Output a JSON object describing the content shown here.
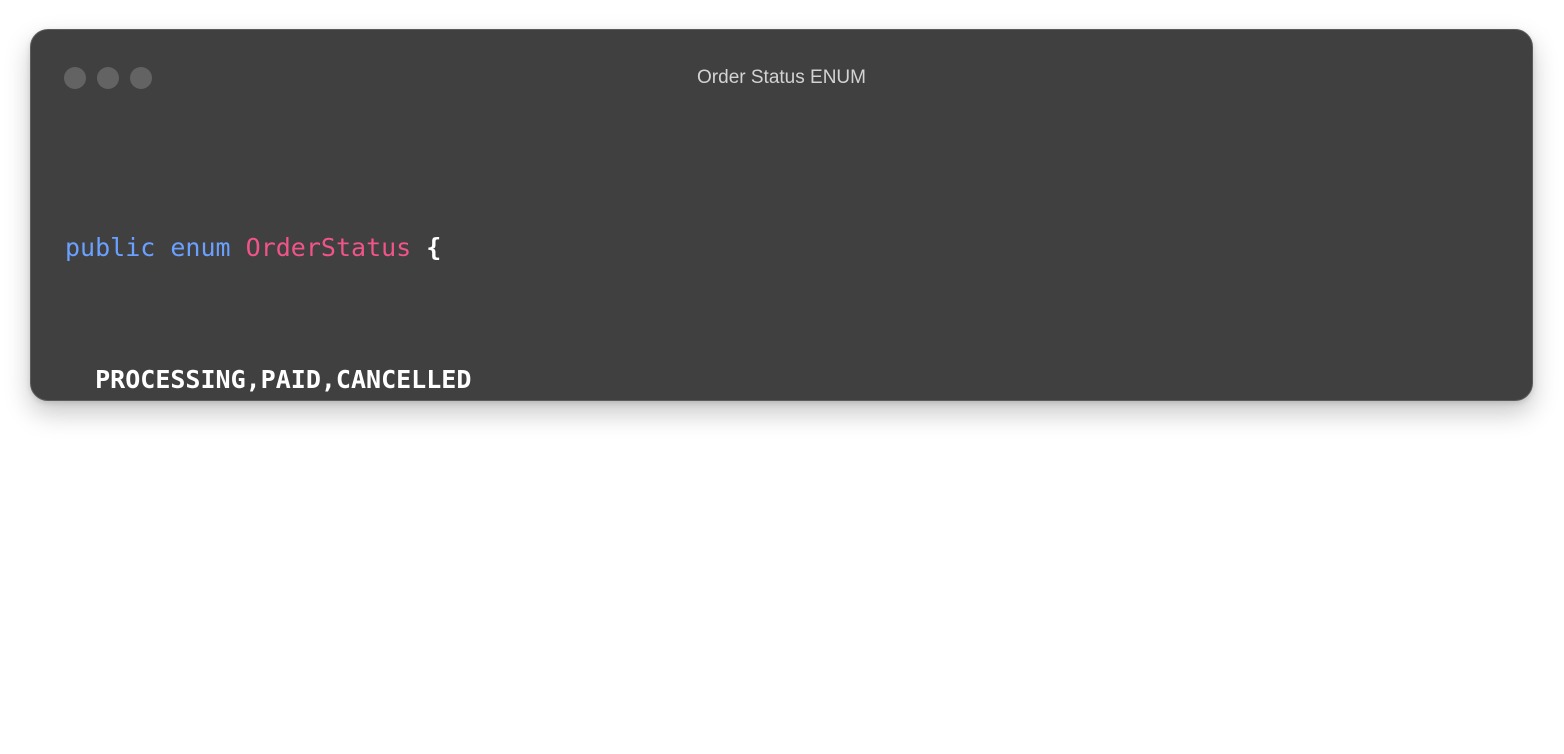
{
  "window": {
    "title": "Order Status ENUM",
    "traffic_lights": [
      "close-dot",
      "minimize-dot",
      "maximize-dot"
    ]
  },
  "code": {
    "kw_public": "public",
    "kw_enum": "enum",
    "type_name": "OrderStatus",
    "open_brace": "{",
    "values": "PROCESSING,PAID,CANCELLED",
    "close_brace": "}"
  },
  "colors": {
    "background": "#404040",
    "keyword": "#6aa0ff",
    "type_name": "#f2538a",
    "text": "#ffffff"
  }
}
